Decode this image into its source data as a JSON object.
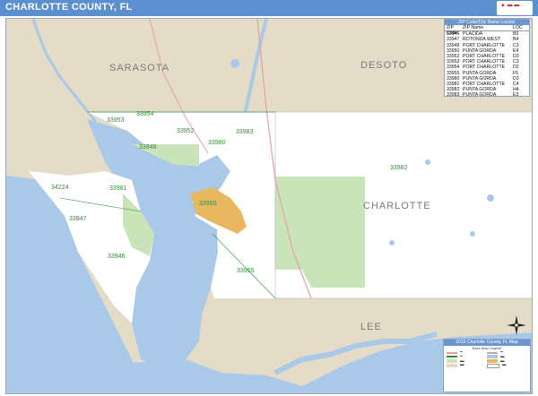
{
  "header": {
    "title": "CHARLOTTE COUNTY, FL",
    "brand_color": "#5b8fd0",
    "logo_icon": "publisher-logo-icon"
  },
  "map": {
    "regions": {
      "sarasota": "SARASOTA",
      "desoto": "DESOTO",
      "charlotte": "CHARLOTTE",
      "lee": "LEE"
    },
    "zip_labels": [
      "33953",
      "33954",
      "33952",
      "33980",
      "33983",
      "33948",
      "33946",
      "34224",
      "33981",
      "33947",
      "33950",
      "33982",
      "33955"
    ],
    "colors": {
      "water": "#aac8e8",
      "land_outside": "#e5dcc8",
      "county_land": "#ffffff",
      "park": "#c9e4b8",
      "urban": "#e8b860",
      "zip_boundary": "#2f8f3a"
    }
  },
  "zip_table": {
    "title": "ZIP Code/City Name Locator",
    "headers": [
      "ZIP Code",
      "ZIP Name",
      "LOC"
    ],
    "rows": [
      [
        "33946",
        "PLACIDA",
        "B5"
      ],
      [
        "33947",
        "ROTONDA WEST",
        "B4"
      ],
      [
        "33948",
        "PORT CHARLOTTE",
        "C3"
      ],
      [
        "33950",
        "PUNTA GORDA",
        "E4"
      ],
      [
        "33952",
        "PORT CHARLOTTE",
        "D3"
      ],
      [
        "33953",
        "PORT CHARLOTTE",
        "C3"
      ],
      [
        "33954",
        "PORT CHARLOTTE",
        "D2"
      ],
      [
        "33955",
        "PUNTA GORDA",
        "F5"
      ],
      [
        "33980",
        "PUNTA GORDA",
        "D3"
      ],
      [
        "33981",
        "PORT CHARLOTTE",
        "C4"
      ],
      [
        "33982",
        "PUNTA GORDA",
        "H4"
      ],
      [
        "33983",
        "PUNTA GORDA",
        "E3"
      ],
      [
        "34224",
        "ENGLEWOOD",
        "A4"
      ]
    ]
  },
  "legend": {
    "title": "2016 Charlotte County, FL Map",
    "subtitle": "Base Map Legend"
  },
  "compass_icon": "north-arrow-icon"
}
